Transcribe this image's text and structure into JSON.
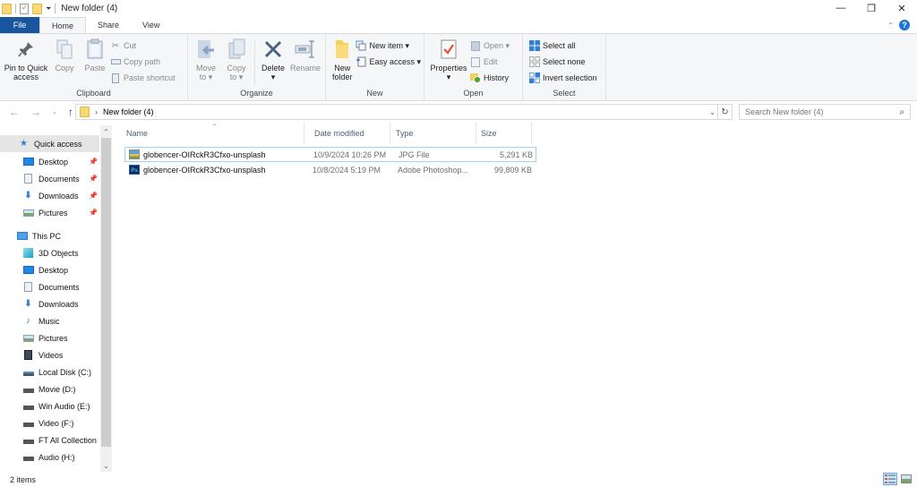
{
  "window": {
    "title": "New folder (4)",
    "controls": {
      "minimize": "—",
      "maximize": "❐",
      "close": "✕"
    }
  },
  "tabs": [
    {
      "label": "File"
    },
    {
      "label": "Home"
    },
    {
      "label": "Share"
    },
    {
      "label": "View"
    }
  ],
  "ribbon": {
    "clipboard": {
      "label": "Clipboard",
      "pin": "Pin to Quick access",
      "pin_line1": "Pin to Quick",
      "pin_line2": "access",
      "copy": "Copy",
      "paste": "Paste",
      "cut": "Cut",
      "copy_path": "Copy path",
      "paste_shortcut": "Paste shortcut"
    },
    "organize": {
      "label": "Organize",
      "move_to_1": "Move",
      "move_to_2": "to ▾",
      "copy_to_1": "Copy",
      "copy_to_2": "to ▾",
      "delete": "Delete",
      "delete_arrow": "▾",
      "rename": "Rename"
    },
    "new": {
      "label": "New",
      "new_folder_1": "New",
      "new_folder_2": "folder",
      "new_item": "New item ▾",
      "easy_access": "Easy access ▾"
    },
    "open": {
      "label": "Open",
      "properties": "Properties",
      "properties_arrow": "▾",
      "open": "Open ▾",
      "edit": "Edit",
      "history": "History"
    },
    "select": {
      "label": "Select",
      "select_all": "Select all",
      "select_none": "Select none",
      "invert_selection": "Invert selection"
    }
  },
  "address": {
    "path_separator": "›",
    "current_folder": "New folder (4)",
    "search_placeholder": "Search New folder (4)"
  },
  "navpane": {
    "quick_access": {
      "label": "Quick access",
      "items": [
        {
          "label": "Desktop",
          "icon": "desktop-icon",
          "pinned": true
        },
        {
          "label": "Documents",
          "icon": "documents-icon",
          "pinned": true
        },
        {
          "label": "Downloads",
          "icon": "downloads-icon",
          "pinned": true
        },
        {
          "label": "Pictures",
          "icon": "pictures-icon",
          "pinned": true
        }
      ]
    },
    "this_pc": {
      "label": "This PC",
      "items": [
        {
          "label": "3D Objects"
        },
        {
          "label": "Desktop"
        },
        {
          "label": "Documents"
        },
        {
          "label": "Downloads"
        },
        {
          "label": "Music"
        },
        {
          "label": "Pictures"
        },
        {
          "label": "Videos"
        },
        {
          "label": "Local Disk (C:)"
        },
        {
          "label": "Movie (D:)"
        },
        {
          "label": "Win Audio (E:)"
        },
        {
          "label": "Video (F:)"
        },
        {
          "label": "FT All Collection"
        },
        {
          "label": "Audio (H:)"
        }
      ]
    }
  },
  "file_list": {
    "columns": [
      "Name",
      "Date modified",
      "Type",
      "Size"
    ],
    "rows": [
      {
        "name": "globencer-OIRckR3Cfxo-unsplash",
        "date": "10/9/2024 10:26 PM",
        "type": "JPG File",
        "size": "5,291 KB",
        "icon": "jpg-file-icon",
        "selected": true
      },
      {
        "name": "globencer-OIRckR3Cfxo-unsplash",
        "date": "10/8/2024 5:19 PM",
        "type": "Adobe Photoshop...",
        "size": "99,809 KB",
        "icon": "psd-file-icon",
        "selected": false
      }
    ]
  },
  "status": {
    "item_count": "2 items"
  }
}
